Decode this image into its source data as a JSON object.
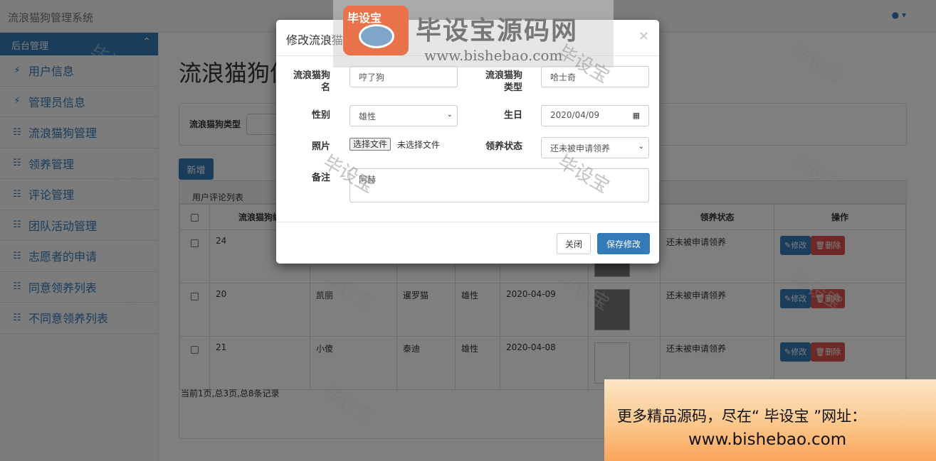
{
  "app": {
    "title": "流浪猫狗管理系统",
    "user_icon": "user-icon"
  },
  "sidebar": {
    "header": "后台管理",
    "items": [
      {
        "label": "用户信息",
        "icon": "bolt-icon"
      },
      {
        "label": "管理员信息",
        "icon": "bolt-icon"
      },
      {
        "label": "流浪猫狗管理",
        "icon": "sitemap-icon"
      },
      {
        "label": "领养管理",
        "icon": "sitemap-icon"
      },
      {
        "label": "评论管理",
        "icon": "sitemap-icon"
      },
      {
        "label": "团队活动管理",
        "icon": "sitemap-icon"
      },
      {
        "label": "志愿者的申请",
        "icon": "sitemap-icon"
      },
      {
        "label": "同意领养列表",
        "icon": "sitemap-icon"
      },
      {
        "label": "不同意领养列表",
        "icon": "sitemap-icon"
      }
    ]
  },
  "main": {
    "page_title": "流浪猫狗信",
    "search_label": "流浪猫狗类型",
    "add_label": "新增",
    "panel_title": "用户评论列表",
    "columns": {
      "id": "流浪猫狗编",
      "status": "领养状态",
      "ops": "操作"
    },
    "rows": [
      {
        "id": "24",
        "name": "",
        "type": "",
        "sex": "",
        "birthday": "",
        "status": "还未被申请领养"
      },
      {
        "id": "20",
        "name": "凯丽",
        "type": "暹罗猫",
        "sex": "雄性",
        "birthday": "2020-04-09",
        "status": "还未被申请领养"
      },
      {
        "id": "21",
        "name": "小傻",
        "type": "泰迪",
        "sex": "雄性",
        "birthday": "2020-04-08",
        "status": "还未被申请领养"
      }
    ],
    "edit_label": "修改",
    "delete_label": "删除",
    "pager": "当前1页,总3页,总8条记录"
  },
  "modal": {
    "title": "修改流浪猫狗信息",
    "close_x": "×",
    "name_label": "流浪猫狗名",
    "name_value": "哼了狗",
    "type_label": "流浪猫狗类型",
    "type_value": "哈士奇",
    "sex_label": "性别",
    "sex_value": "雄性",
    "birthday_label": "生日",
    "birthday_value": "2020/04/09",
    "photo_label": "照片",
    "file_button": "选择文件",
    "file_status": "未选择文件",
    "adopt_label": "领养状态",
    "adopt_value": "还未被申请领养",
    "remark_label": "备注",
    "remark_value": "阿赫",
    "btn_close": "关闭",
    "btn_save": "保存修改"
  },
  "watermark": {
    "text": "毕设宝",
    "logo_main": "毕设宝源码网",
    "logo_url": "www.bishebao.com",
    "logo_badge": "毕设宝",
    "promo_line1": "更多精品源码，尽在“ 毕设宝 ”网址：",
    "promo_line2": "www.bishebao.com"
  }
}
